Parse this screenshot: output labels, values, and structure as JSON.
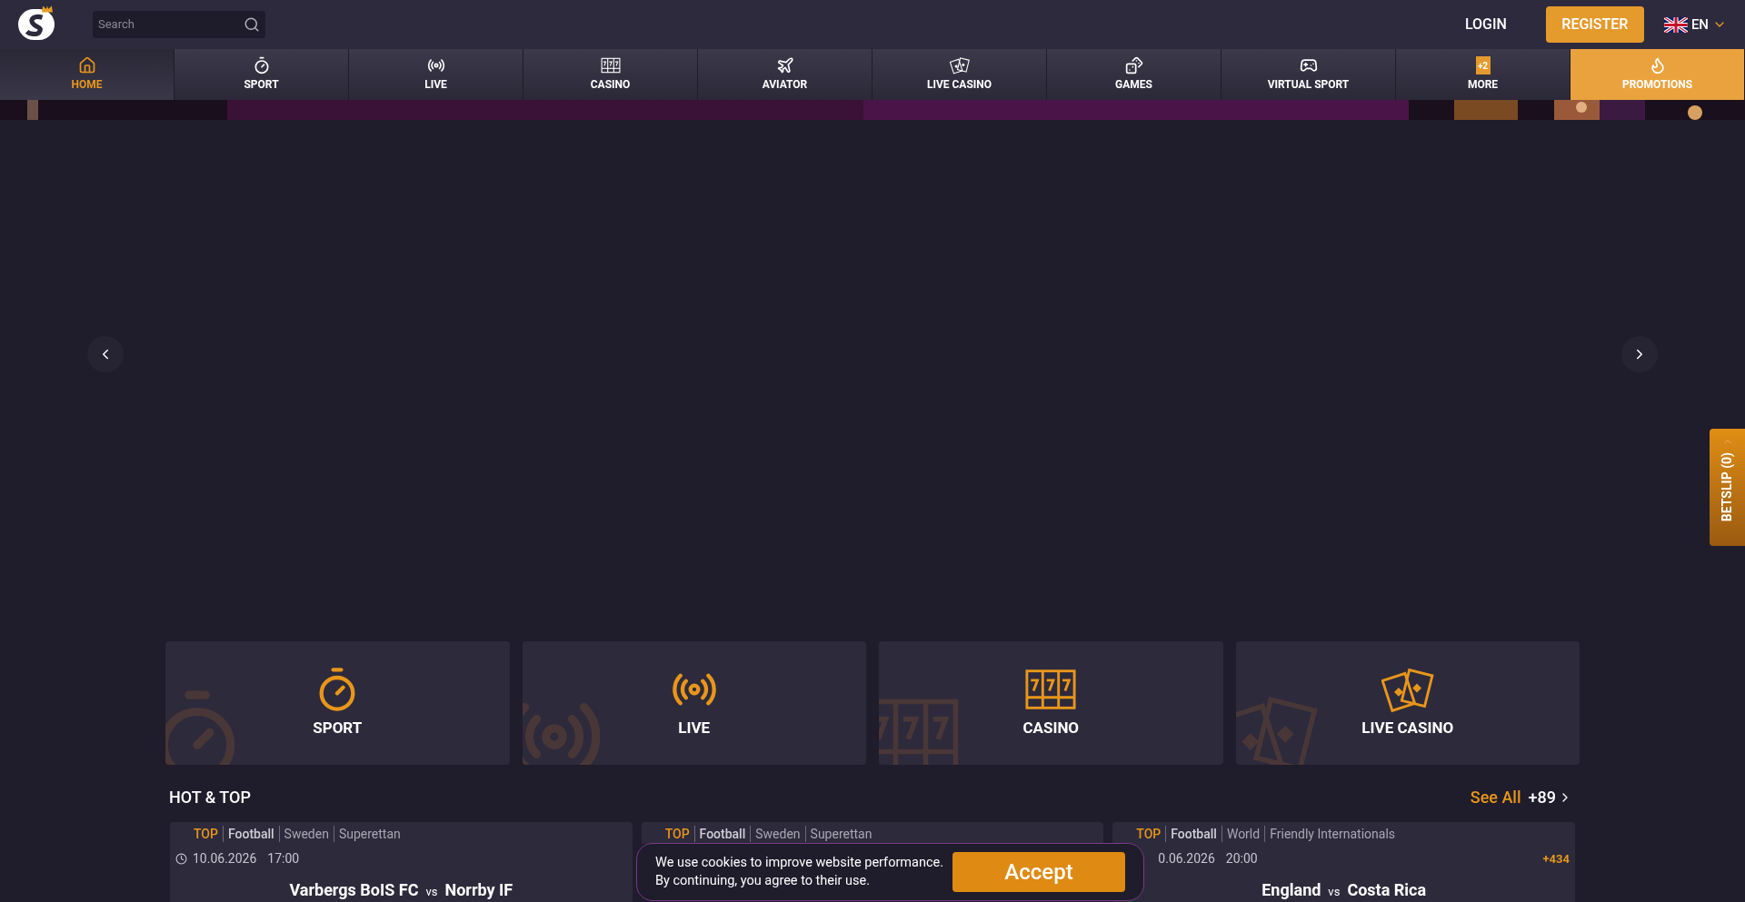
{
  "header": {
    "search": {
      "placeholder": "Search"
    },
    "login": "LOGIN",
    "register": "REGISTER",
    "language": "EN"
  },
  "nav": [
    {
      "label": "HOME",
      "kind": "home",
      "selected": true
    },
    {
      "label": "SPORT",
      "kind": "sport",
      "selected": false
    },
    {
      "label": "LIVE",
      "kind": "live",
      "selected": false
    },
    {
      "label": "CASINO",
      "kind": "casino",
      "selected": false
    },
    {
      "label": "AVIATOR",
      "kind": "aviator",
      "selected": false
    },
    {
      "label": "LIVE CASINO",
      "kind": "livecasino",
      "selected": false
    },
    {
      "label": "GAMES",
      "kind": "games",
      "selected": false
    },
    {
      "label": "VIRTUAL SPORT",
      "kind": "virtual",
      "selected": false
    },
    {
      "label": "MORE",
      "kind": "more",
      "badge": "+2",
      "selected": false
    },
    {
      "label": "PROMOTIONS",
      "kind": "promotions",
      "selected": false
    }
  ],
  "categories": [
    {
      "label": "SPORT",
      "kind": "sport"
    },
    {
      "label": "LIVE",
      "kind": "live"
    },
    {
      "label": "CASINO",
      "kind": "casino"
    },
    {
      "label": "LIVE CASINO",
      "kind": "livecasino"
    }
  ],
  "hot_top": {
    "title": "HOT & TOP",
    "see_all": "See All",
    "count": "+89",
    "matches": [
      {
        "tag": "TOP",
        "sport": "Football",
        "country": "Sweden",
        "league": "Superettan",
        "clock": true,
        "date": "10.06.2026",
        "time": "17:00",
        "home": "Varbergs BoIS FC",
        "vs": "vs",
        "away": "Norrby IF"
      },
      {
        "tag": "TOP",
        "sport": "Football",
        "country": "Sweden",
        "league": "Superettan"
      },
      {
        "tag": "TOP",
        "sport": "Football",
        "country": "World",
        "league": "Friendly Internationals",
        "clock": false,
        "date": "0.06.2026",
        "time": "20:00",
        "more": "+434",
        "home": "England",
        "vs": "vs",
        "away": "Costa Rica"
      }
    ]
  },
  "cookie": {
    "lines": [
      "We use cookies to improve website performance.",
      "By continuing, you agree to their use."
    ],
    "button": "Accept"
  },
  "betslip": "BETSLIP (0)"
}
